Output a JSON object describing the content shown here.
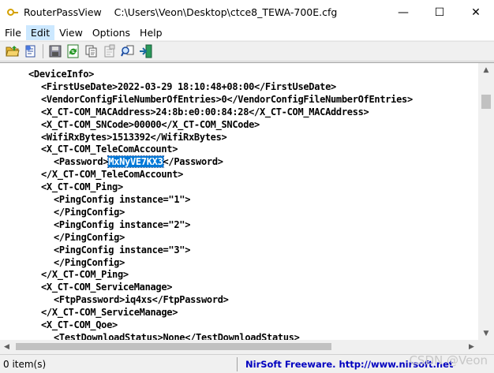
{
  "window": {
    "app_name": "RouterPassView",
    "file_path": "C:\\Users\\Veon\\Desktop\\ctce8_TEWA-700E.cfg",
    "minimize_glyph": "—",
    "maximize_glyph": "☐",
    "close_glyph": "✕"
  },
  "menu": {
    "items": [
      {
        "label": "File"
      },
      {
        "label": "Edit"
      },
      {
        "label": "View"
      },
      {
        "label": "Options"
      },
      {
        "label": "Help"
      }
    ]
  },
  "toolbar": {
    "buttons": [
      "open-folder-icon",
      "open-file-icon",
      "save-icon",
      "refresh-icon",
      "copy-icon",
      "properties-icon",
      "find-icon",
      "exit-icon"
    ]
  },
  "content": {
    "lines": [
      {
        "indent": 0,
        "text": "<DeviceInfo>"
      },
      {
        "indent": 1,
        "text": "<FirstUseDate>2022-03-29 18:10:48+08:00</FirstUseDate>"
      },
      {
        "indent": 1,
        "text": "<VendorConfigFileNumberOfEntries>0</VendorConfigFileNumberOfEntries>"
      },
      {
        "indent": 1,
        "text": "<X_CT-COM_MACAddress>24:8b:e0:00:84:28</X_CT-COM_MACAddress>"
      },
      {
        "indent": 1,
        "text": "<X_CT-COM_SNCode>00000</X_CT-COM_SNCode>"
      },
      {
        "indent": 1,
        "text": "<WifiRxBytes>1513392</WifiRxBytes>"
      },
      {
        "indent": 1,
        "text": "<X_CT-COM_TeleComAccount>"
      },
      {
        "indent": 2,
        "pre": "<Password>",
        "highlight": "MxNyVE7KX3",
        "post": "</Password>"
      },
      {
        "indent": 1,
        "text": "</X_CT-COM_TeleComAccount>"
      },
      {
        "indent": 1,
        "text": "<X_CT-COM_Ping>"
      },
      {
        "indent": 2,
        "text": "<PingConfig instance=\"1\">"
      },
      {
        "indent": 2,
        "text": "</PingConfig>"
      },
      {
        "indent": 2,
        "text": "<PingConfig instance=\"2\">"
      },
      {
        "indent": 2,
        "text": "</PingConfig>"
      },
      {
        "indent": 2,
        "text": "<PingConfig instance=\"3\">"
      },
      {
        "indent": 2,
        "text": "</PingConfig>"
      },
      {
        "indent": 1,
        "text": "</X_CT-COM_Ping>"
      },
      {
        "indent": 1,
        "text": "<X_CT-COM_ServiceManage>"
      },
      {
        "indent": 2,
        "text": "<FtpPassword>iq4xs</FtpPassword>"
      },
      {
        "indent": 1,
        "text": "</X_CT-COM_ServiceManage>"
      },
      {
        "indent": 1,
        "text": "<X_CT-COM_Qoe>"
      },
      {
        "indent": 2,
        "text": "<TestDownloadStatus>None</TestDownloadStatus>"
      }
    ]
  },
  "statusbar": {
    "count": "0 item(s)",
    "credit": "NirSoft Freeware.  http://www.nirsoft.net"
  },
  "watermark": "CSDN @Veon"
}
